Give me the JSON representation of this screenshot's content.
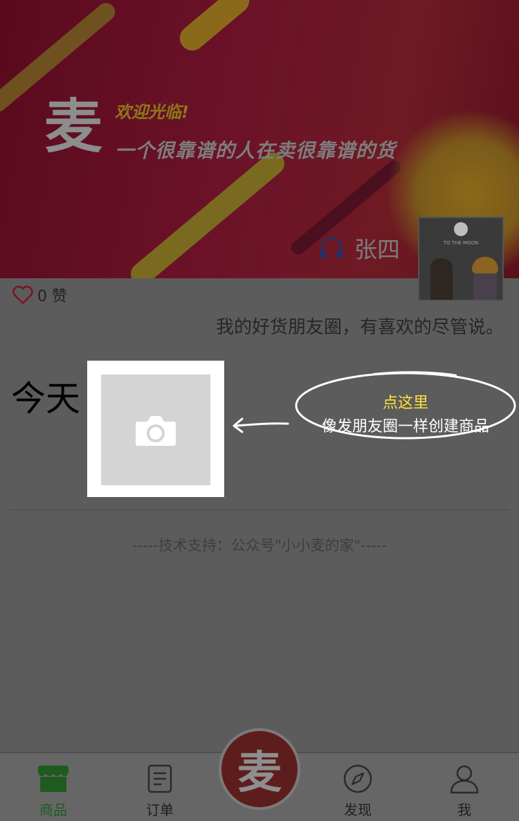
{
  "banner": {
    "logo_char": "麦",
    "welcome": "欢迎光临!",
    "tagline": "一个很靠谱的人在卖很靠谱的货",
    "author_name": "张四"
  },
  "avatar": {
    "caption": "TO THE MOON"
  },
  "likes": {
    "count": "0 赞"
  },
  "intro": "我的好货朋友圈，有喜欢的尽管说。",
  "feed": {
    "today_label": "今天"
  },
  "hint": {
    "title": "点这里",
    "text": "像发朋友圈一样创建商品"
  },
  "footer": {
    "support": "-----技术支持：公众号\"小小麦的家\"-----"
  },
  "tabbar": {
    "center_char": "麦",
    "tabs": [
      {
        "label": "商品",
        "icon": "store-icon",
        "active": true
      },
      {
        "label": "订单",
        "icon": "order-icon"
      },
      {
        "label": "发现",
        "icon": "compass-icon"
      },
      {
        "label": "我",
        "icon": "user-icon"
      }
    ]
  },
  "colors": {
    "active_tab": "#1f5a1f",
    "hint_highlight": "#ffe23a",
    "banner": "#6c1229"
  }
}
